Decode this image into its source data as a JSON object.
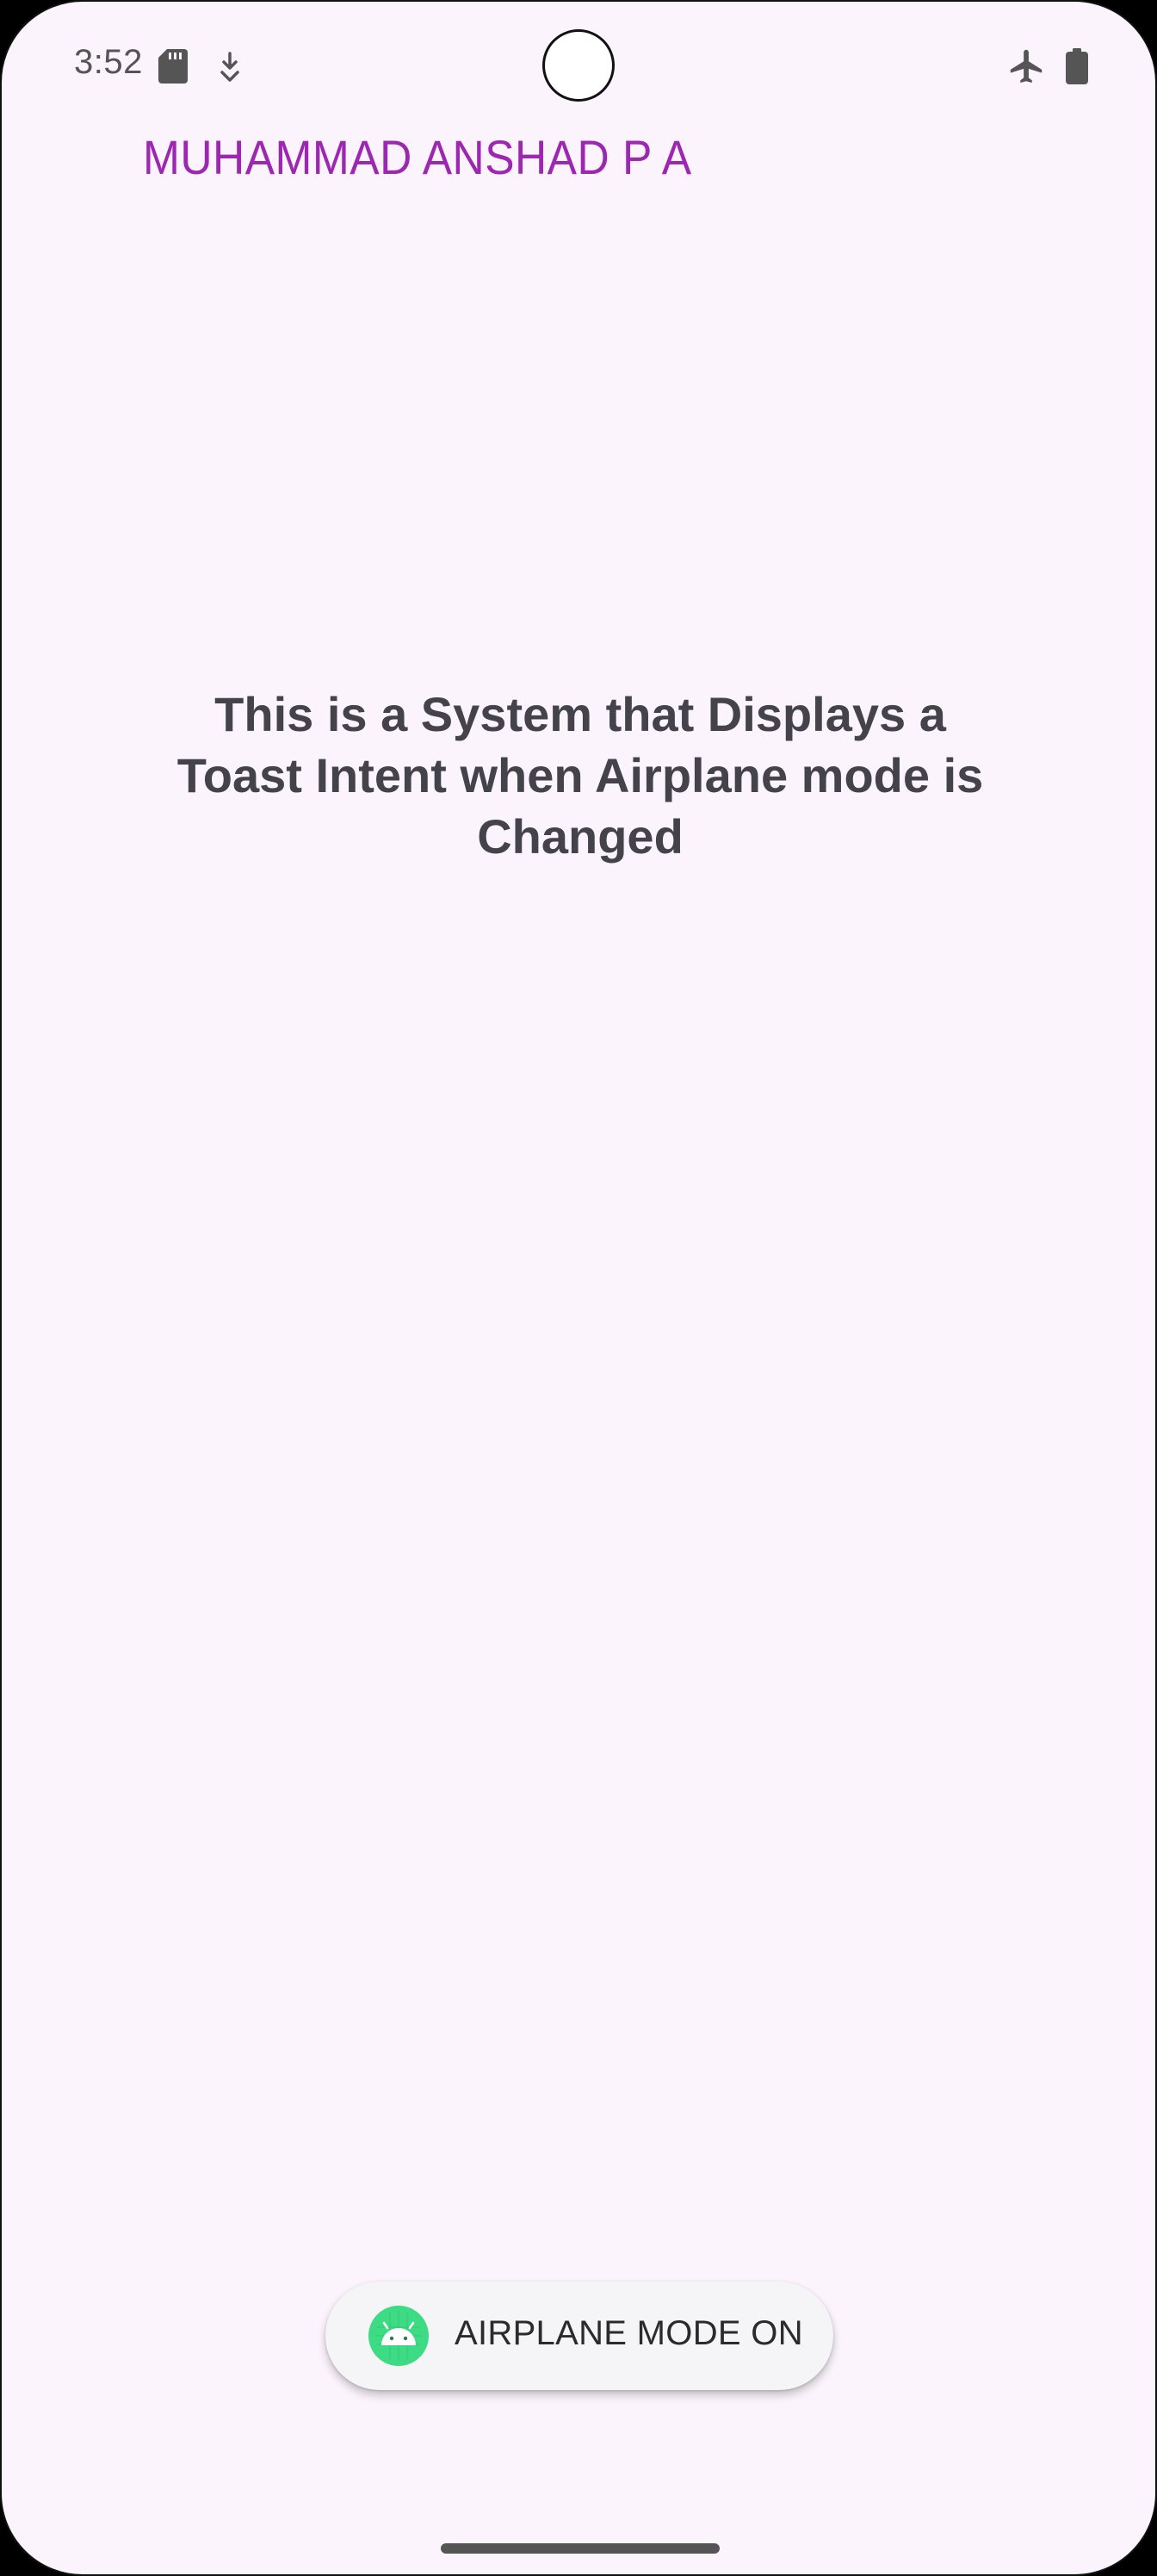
{
  "status_bar": {
    "time": "3:52",
    "icons": [
      "sd-card-icon",
      "download-icon",
      "airplane-icon",
      "battery-icon"
    ]
  },
  "app": {
    "title": "MUHAMMAD ANSHAD P A",
    "description": "This is a System that Displays a Toast Intent when  Airplane mode is Changed"
  },
  "toast": {
    "message": "AIRPLANE MODE ON",
    "icon": "android-icon"
  },
  "colors": {
    "background": "#fcf4fc",
    "title": "#9c27b0",
    "description": "#44424a",
    "toast_background": "#f5f5f8",
    "android_icon": "#3ddc84"
  }
}
